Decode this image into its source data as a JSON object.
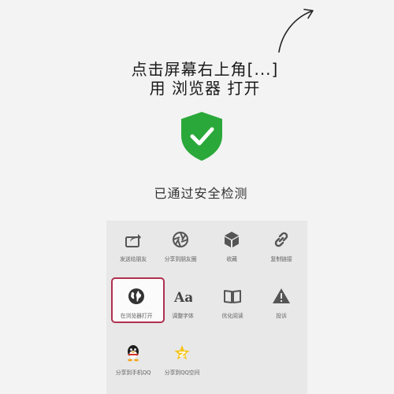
{
  "instruction": {
    "line1": "点击屏幕右上角[...]",
    "line2": "用 浏览器 打开"
  },
  "status": {
    "text": "已通过安全检测",
    "color": "#2aa83a"
  },
  "share_sheet": {
    "rows": [
      [
        {
          "icon": "share-icon",
          "label": "发送给朋友"
        },
        {
          "icon": "moments-icon",
          "label": "分享到朋友圈"
        },
        {
          "icon": "cube-icon",
          "label": "收藏"
        },
        {
          "icon": "link-icon",
          "label": "复制链接"
        }
      ],
      [
        {
          "icon": "globe-icon",
          "label": "在浏览器打开",
          "highlighted": true
        },
        {
          "icon": "font-size-icon",
          "label": "调整字体"
        },
        {
          "icon": "book-icon",
          "label": "优化阅读"
        },
        {
          "icon": "warning-icon",
          "label": "投诉"
        }
      ],
      [
        {
          "icon": "qq-penguin-icon",
          "label": "分享到手机QQ"
        },
        {
          "icon": "qzone-star-icon",
          "label": "分享到QQ空间"
        }
      ]
    ],
    "highlight_color": "#b03050"
  }
}
